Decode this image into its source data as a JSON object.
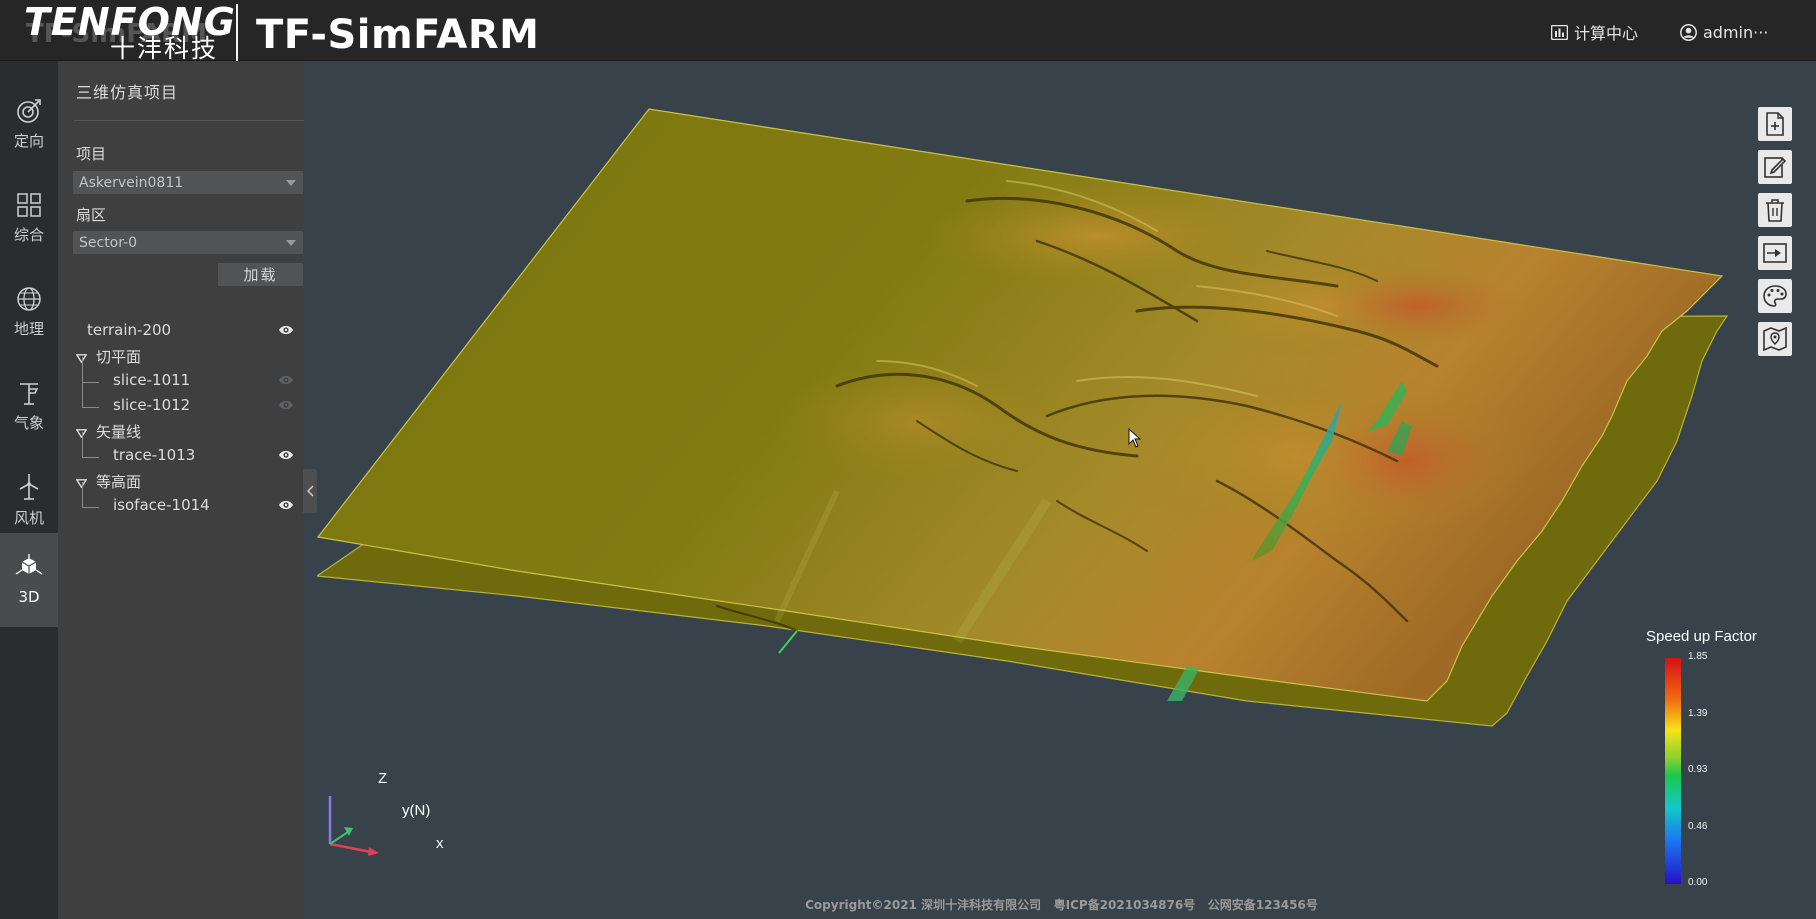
{
  "header": {
    "logo_en": "TENFONG",
    "logo_ghost": "TF-SimFARM",
    "logo_cn": "十沣科技",
    "app_title": "TF-SimFARM",
    "compute_center": "计算中心",
    "user": "admin···"
  },
  "rail": {
    "items": [
      {
        "label": "定向",
        "icon": "target-icon"
      },
      {
        "label": "综合",
        "icon": "grid-icon"
      },
      {
        "label": "地理",
        "icon": "globe-icon"
      },
      {
        "label": "气象",
        "icon": "weather-icon"
      },
      {
        "label": "风机",
        "icon": "turbine-icon"
      },
      {
        "label": "3D",
        "icon": "cube-icon"
      }
    ],
    "active": "3D"
  },
  "panel": {
    "title": "三维仿真项目",
    "project_label": "项目",
    "project_value": "Askervein0811",
    "sector_label": "扇区",
    "sector_value": "Sector-0",
    "load_button": "加载",
    "tree": {
      "terrain": "terrain-200",
      "slice_group": "切平面",
      "slice_1": "slice-1011",
      "slice_2": "slice-1012",
      "vector_group": "矢量线",
      "trace_1": "trace-1013",
      "iso_group": "等高面",
      "iso_1": "isoface-1014"
    }
  },
  "toolbar": {
    "tools": [
      "new-file-icon",
      "edit-icon",
      "delete-icon",
      "animation-icon",
      "palette-icon",
      "map-icon"
    ]
  },
  "legend": {
    "title": "Speed up Factor",
    "ticks": [
      "1.85",
      "1.39",
      "0.93",
      "0.46",
      "0.00"
    ],
    "colors": {
      "max": "#d70e14",
      "mid": "#1bc84b",
      "min": "#2510c8"
    }
  },
  "axes": {
    "z": "Z",
    "y": "y(N)",
    "x": "x"
  },
  "footer": {
    "copyright": "Copyright©2021 深圳十沣科技有限公司",
    "icp": "粤ICP备2021034876号",
    "security": "公网安备123456号"
  }
}
